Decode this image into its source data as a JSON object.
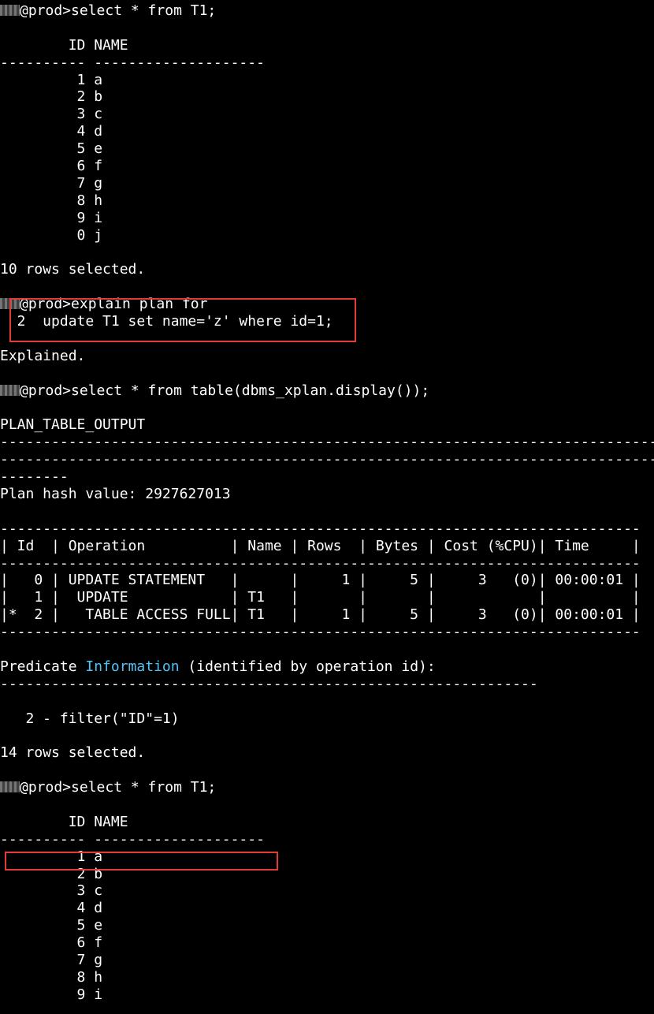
{
  "lines": [
    "@prod>select * from T1;",
    "",
    "        ID NAME",
    "---------- --------------------",
    "         1 a",
    "         2 b",
    "         3 c",
    "         4 d",
    "         5 e",
    "         6 f",
    "         7 g",
    "         8 h",
    "         9 i",
    "         0 j",
    "",
    "10 rows selected.",
    "",
    "@prod>explain plan for",
    "  2  update T1 set name='z' where id=1;",
    "",
    "Explained.",
    "",
    "@prod>select * from table(dbms_xplan.display());",
    "",
    "PLAN_TABLE_OUTPUT",
    "------------------------------------------------------------------------------------------------",
    "------------------------------------------------------------------------------------------------",
    "--------",
    "Plan hash value: 2927627013",
    "",
    "---------------------------------------------------------------------------",
    "| Id  | Operation          | Name | Rows  | Bytes | Cost (%CPU)| Time     |",
    "---------------------------------------------------------------------------",
    "|   0 | UPDATE STATEMENT   |      |     1 |     5 |     3   (0)| 00:00:01 |",
    "|   1 |  UPDATE            | T1   |       |       |            |          |",
    "|*  2 |   TABLE ACCESS FULL| T1   |     1 |     5 |     3   (0)| 00:00:01 |",
    "---------------------------------------------------------------------------",
    "",
    "Predicate ",
    "---------------------------------------------------------------",
    "",
    "   2 - filter(\"ID\"=1)",
    "",
    "14 rows selected.",
    "",
    "@prod>select * from T1;",
    "",
    "        ID NAME",
    "---------- --------------------",
    "         1 a",
    "         2 b",
    "         3 c",
    "         4 d",
    "         5 e",
    "         6 f",
    "         7 g",
    "         8 h",
    "         9 i"
  ],
  "predicate_highlight_word": "Information",
  "predicate_suffix": " (identified by operation id):",
  "prompt_lines": [
    0,
    17,
    22,
    45
  ],
  "predicate_line": 38,
  "highlight_color": "#4fc3f7",
  "annotation_color": "#e23b3b"
}
